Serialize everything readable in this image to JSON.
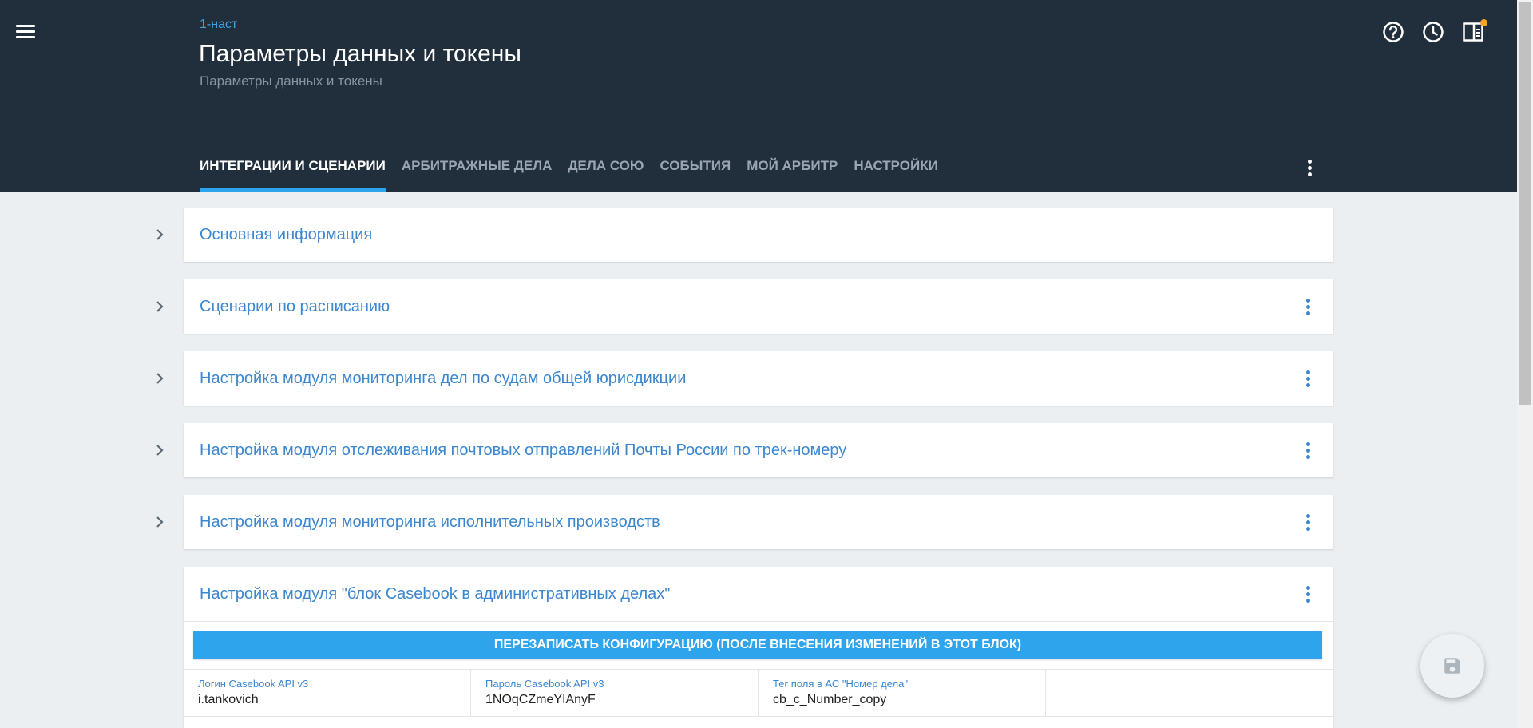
{
  "header": {
    "breadcrumb": "1-наст",
    "title": "Параметры данных и токены",
    "subtitle": "Параметры данных и токены",
    "icons": [
      "menu-icon",
      "help-icon",
      "history-icon",
      "panel-icon"
    ]
  },
  "tabs": [
    {
      "label": "ИНТЕГРАЦИИ И СЦЕНАРИИ",
      "active": true
    },
    {
      "label": "АРБИТРАЖНЫЕ ДЕЛА",
      "active": false
    },
    {
      "label": "ДЕЛА СОЮ",
      "active": false
    },
    {
      "label": "СОБЫТИЯ",
      "active": false
    },
    {
      "label": "МОЙ АРБИТР",
      "active": false
    },
    {
      "label": "НАСТРОЙКИ",
      "active": false
    }
  ],
  "sections": [
    {
      "title": "Основная информация"
    },
    {
      "title": "Сценарии по расписанию"
    },
    {
      "title": "Настройка модуля мониторинга дел по судам общей юрисдикции"
    },
    {
      "title": "Настройка модуля отслеживания почтовых отправлений Почты России по трек-номеру"
    },
    {
      "title": "Настройка модуля мониторинга исполнительных производств"
    }
  ],
  "expanded_section": {
    "title": "Настройка модуля \"блок Casebook в административных делах\"",
    "button_label": "ПЕРЕЗАПИСАТЬ КОНФИГУРАЦИЮ (ПОСЛЕ ВНЕСЕНИЯ ИЗМЕНЕНИЙ В ЭТОТ БЛОК)",
    "fields": [
      {
        "label": "Логин Casebook API v3",
        "value": "i.tankovich"
      },
      {
        "label": "Пароль Casebook API v3",
        "value": "1NOqCZmeYIAnyF"
      },
      {
        "label": "Тег поля в АС \"Номер дела\"",
        "value": "cb_c_Number_copy"
      },
      {
        "label": "",
        "value": ""
      }
    ]
  },
  "colors": {
    "header_bg": "#212f3d",
    "accent": "#2ea4ec",
    "link": "#3d87cf",
    "page_bg": "#eceff1",
    "notification": "#f5a623"
  }
}
